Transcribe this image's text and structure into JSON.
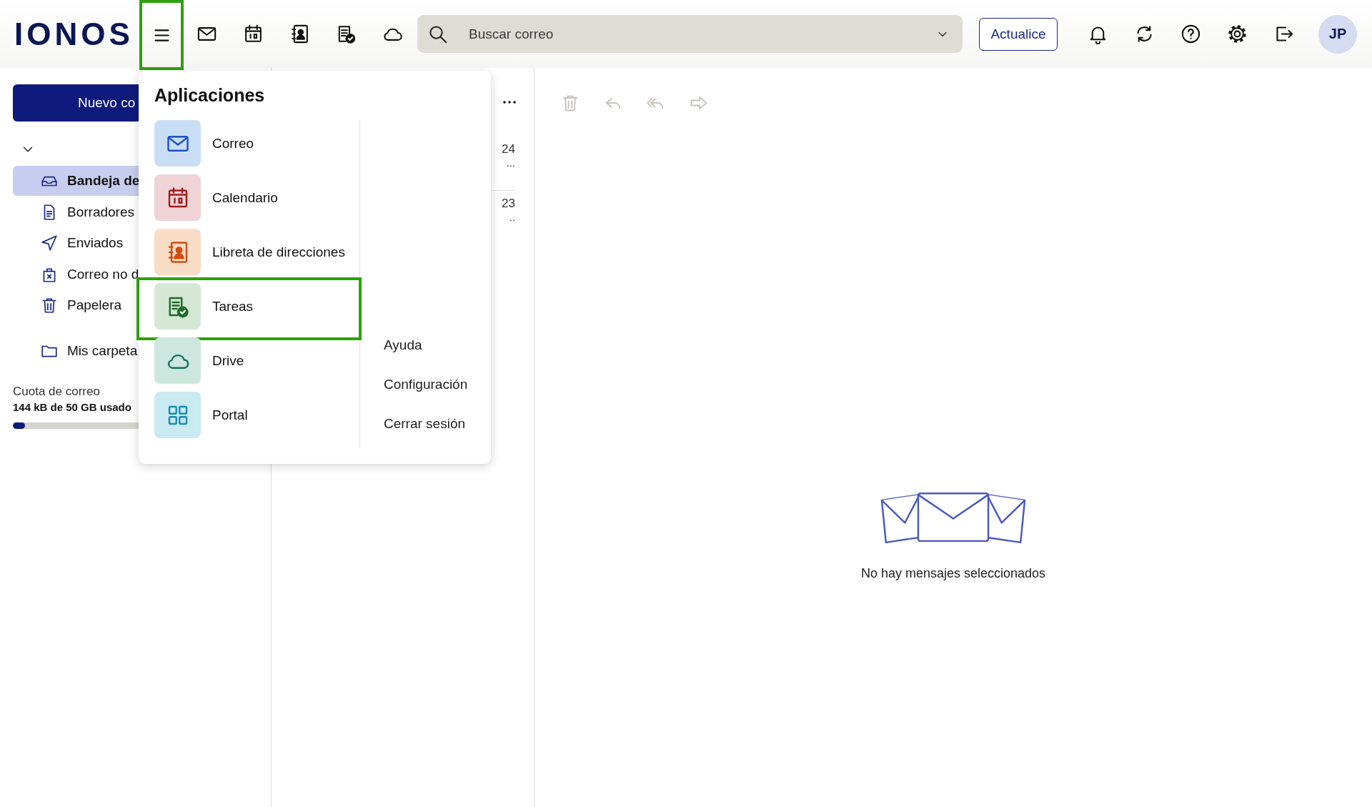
{
  "logo": "IONOS",
  "header": {
    "menu_button": {
      "highlighted": true
    },
    "app_buttons": [
      {
        "kind": "mail"
      },
      {
        "kind": "calendar"
      },
      {
        "kind": "contacts"
      },
      {
        "kind": "tasks"
      },
      {
        "kind": "cloud"
      }
    ],
    "search": {
      "placeholder": "Buscar correo"
    },
    "upgrade_button": "Actualice",
    "tool_buttons": [
      {
        "kind": "bell"
      },
      {
        "kind": "sync"
      },
      {
        "kind": "help"
      },
      {
        "kind": "gear"
      },
      {
        "kind": "logout"
      }
    ],
    "avatar": "JP"
  },
  "sidebar": {
    "new_button": "Nuevo co",
    "folders": [
      {
        "label": "Bandeja de",
        "kind": "inbox",
        "selected": true
      },
      {
        "label": "Borradores",
        "kind": "draft",
        "selected": false
      },
      {
        "label": "Enviados",
        "kind": "send",
        "selected": false
      },
      {
        "label": "Correo no d",
        "kind": "spam",
        "selected": false
      },
      {
        "label": "Papelera",
        "kind": "trash",
        "selected": false
      }
    ],
    "my_folders": "Mis carpeta",
    "quota": {
      "label": "Cuota de correo",
      "usage": "144 kB de 50 GB usado",
      "level": 0.05
    }
  },
  "mail_list": {
    "rows": [
      {
        "date": "24",
        "preview": "..."
      },
      {
        "date": "23",
        "preview": ".."
      }
    ]
  },
  "reader": {
    "toolbar": [
      {
        "kind": "trash",
        "disabled": true
      },
      {
        "kind": "reply",
        "disabled": true
      },
      {
        "kind": "replyall",
        "disabled": true
      },
      {
        "kind": "forward",
        "disabled": true
      }
    ],
    "empty_text": "No hay mensajes seleccionados"
  },
  "apps_menu": {
    "title": "Aplicaciones",
    "items": [
      {
        "label": "Correo",
        "kind": "mail",
        "highlighted": false
      },
      {
        "label": "Calendario",
        "kind": "calendar",
        "highlighted": false
      },
      {
        "label": "Libreta de direcciones",
        "kind": "contacts",
        "highlighted": false
      },
      {
        "label": "Tareas",
        "kind": "tasks",
        "highlighted": true
      },
      {
        "label": "Drive",
        "kind": "cloud",
        "highlighted": false
      },
      {
        "label": "Portal",
        "kind": "grid",
        "highlighted": false
      }
    ],
    "links": [
      "Ayuda",
      "Configuración",
      "Cerrar sesión"
    ]
  }
}
